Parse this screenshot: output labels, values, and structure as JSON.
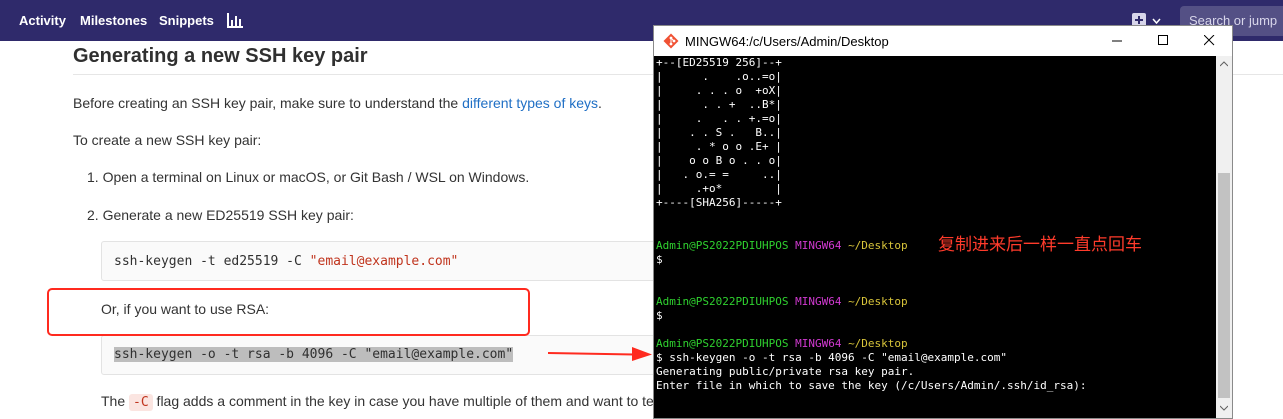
{
  "nav": {
    "activity": "Activity",
    "milestones": "Milestones",
    "snippets": "Snippets",
    "search_placeholder": "Search or jump"
  },
  "doc": {
    "title": "Generating a new SSH key pair",
    "intro_before": "Before creating an SSH key pair, make sure to understand the ",
    "intro_link": "different types of keys",
    "intro_after": ".",
    "create_text": "To create a new SSH key pair:",
    "step1": "1. Open a terminal on Linux or macOS, or Git Bash / WSL on Windows.",
    "step2": "2. Generate a new ED25519 SSH key pair:",
    "code1_cmd": "ssh-keygen -t ed25519 -C ",
    "code1_str": "\"email@example.com\"",
    "rsa_text": "Or, if you want to use RSA:",
    "code2": "ssh-keygen -o -t rsa -b 4096 -C \"email@example.com\"",
    "flag_before": "The ",
    "flag_code": "-C",
    "flag_after": " flag adds a comment in the key in case you have multiple of them and want to tell which is which. It is optional."
  },
  "terminal": {
    "title": "MINGW64:/c/Users/Admin/Desktop",
    "art": [
      "+--[ED25519 256]--+",
      "|      .    .o..=o|",
      "|     . . . o  +oX|",
      "|      . . +  ..B*|",
      "|     .   . . +.=o|",
      "|    . . S .   B..|",
      "|     . * o o .E+ |",
      "|    o o B o . . o|",
      "|   . o.= =     ..|",
      "|     .+o*        |",
      "+----[SHA256]-----+"
    ],
    "user": "Admin@PS2022PDIUHPOS",
    "shell": "MINGW64",
    "path": "~/Desktop",
    "prompt": "$",
    "command": "$ ssh-keygen -o -t rsa -b 4096 -C \"email@example.com\"",
    "out1": "Generating public/private rsa key pair.",
    "out2": "Enter file in which to save the key (/c/Users/Admin/.ssh/id_rsa):",
    "annotation": "复制进来后一样一直点回车"
  },
  "colors": {
    "nav_bg": "#2f2a6b",
    "link": "#1f6fc5",
    "string": "#c0341d",
    "annotation_red": "#ff2a1f",
    "term_green": "#2fd12f",
    "term_magenta": "#d23ad2",
    "term_yellow": "#d8c43a"
  }
}
